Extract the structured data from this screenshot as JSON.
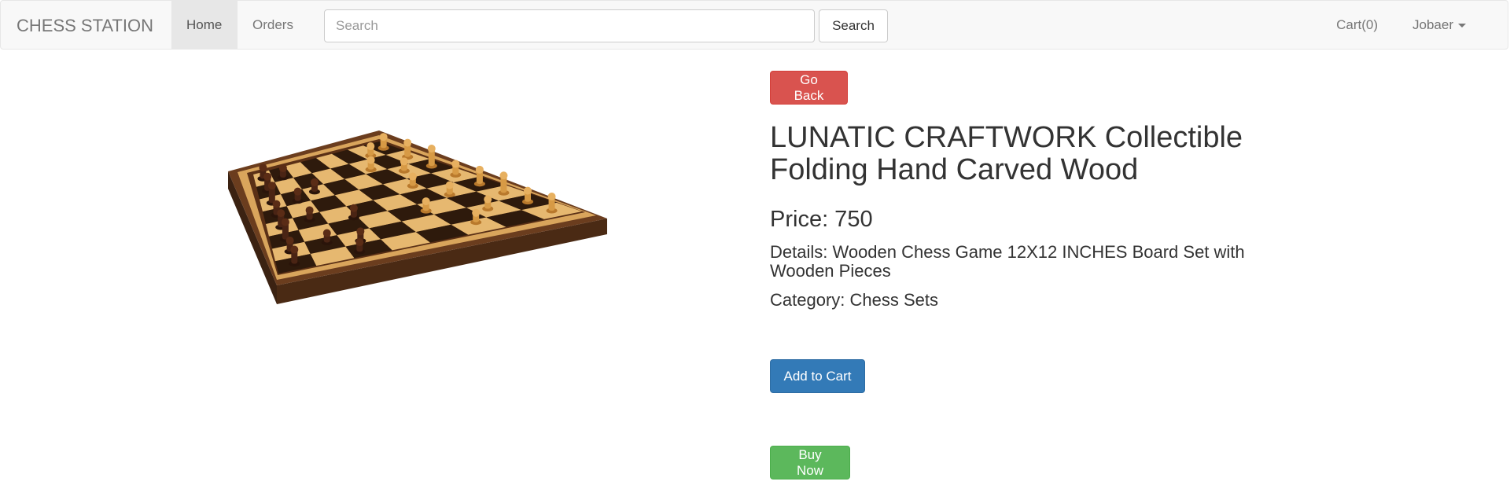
{
  "navbar": {
    "brand": "CHESS STATION",
    "home": "Home",
    "orders": "Orders",
    "search_placeholder": "Search",
    "search_button": "Search",
    "cart": "Cart(0)",
    "user": "Jobaer"
  },
  "product": {
    "go_back": "Go Back",
    "title": "LUNATIC CRAFTWORK Collectible Folding Hand Carved Wood",
    "price": "Price: 750",
    "details": "Details: Wooden Chess Game 12X12 INCHES Board Set with Wooden Pieces",
    "category": "Category: Chess Sets",
    "add_to_cart": "Add to Cart",
    "buy_now": "Buy Now",
    "image": "chess-board-image"
  },
  "colors": {
    "danger": "#d9534f",
    "primary": "#337ab7",
    "success": "#5cb85c",
    "navbar_bg": "#f8f8f8"
  }
}
